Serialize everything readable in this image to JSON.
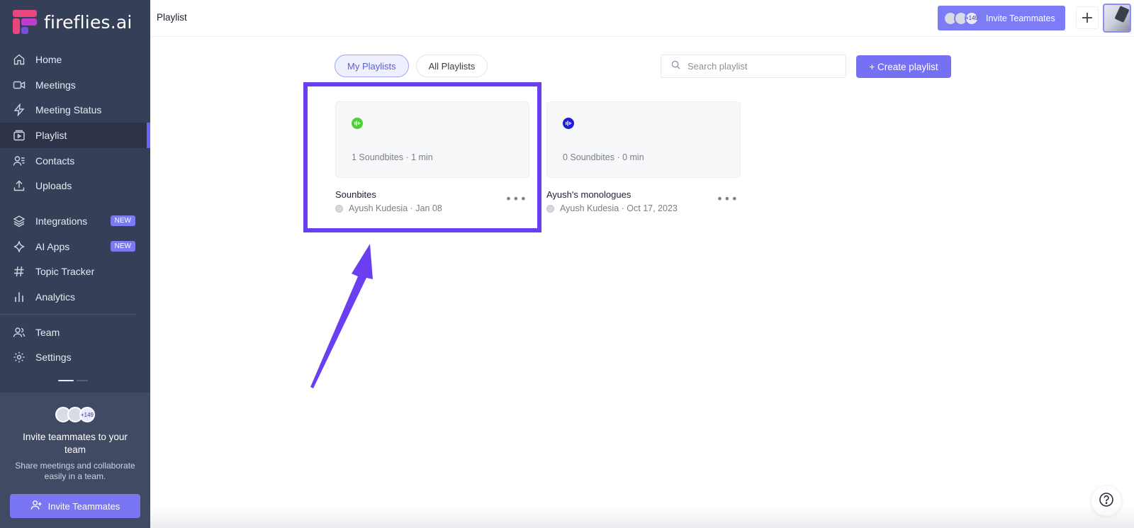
{
  "brand": {
    "name": "fireflies.ai",
    "colors": {
      "accent": "#7671f4",
      "sidebar": "#363f58",
      "highlight": "#6a3ff2"
    }
  },
  "header": {
    "title": "Playlist",
    "invite_label": "Invite Teammates",
    "invite_count": "+149",
    "add_icon": "plus-icon"
  },
  "sidebar": {
    "items": [
      {
        "label": "Home",
        "icon": "home-icon"
      },
      {
        "label": "Meetings",
        "icon": "video-icon"
      },
      {
        "label": "Meeting Status",
        "icon": "bolt-icon"
      },
      {
        "label": "Playlist",
        "icon": "playlist-icon",
        "active": true
      },
      {
        "label": "Contacts",
        "icon": "contacts-icon"
      },
      {
        "label": "Uploads",
        "icon": "upload-icon"
      },
      {
        "label": "Integrations",
        "icon": "layers-icon",
        "badge": "NEW"
      },
      {
        "label": "AI Apps",
        "icon": "sparkle-icon",
        "badge": "NEW"
      },
      {
        "label": "Topic Tracker",
        "icon": "hash-icon"
      },
      {
        "label": "Analytics",
        "icon": "bar-chart-icon"
      },
      {
        "label": "Team",
        "icon": "team-icon"
      },
      {
        "label": "Settings",
        "icon": "gear-icon"
      }
    ],
    "invite_panel": {
      "count": "+149",
      "title": "Invite teammates to your team",
      "subtitle": "Share meetings and collaborate easily in a team.",
      "button_label": "Invite Teammates"
    }
  },
  "main": {
    "tabs": [
      {
        "label": "My Playlists",
        "active": true
      },
      {
        "label": "All Playlists",
        "active": false
      }
    ],
    "search": {
      "placeholder": "Search playlist",
      "value": ""
    },
    "create_label": "+ Create playlist",
    "playlists": [
      {
        "title": "Sounbites",
        "meta": "1 Soundbites · 1 min",
        "owner": "Ayush Kudesia · Jan 08",
        "icon_color": "#4cd137"
      },
      {
        "title": "Ayush's monologues",
        "meta": "0 Soundbites · 0 min",
        "owner": "Ayush Kudesia · Oct 17, 2023",
        "icon_color": "#1e1ed8"
      }
    ],
    "more_label": "•••"
  },
  "help_icon": "help-icon"
}
